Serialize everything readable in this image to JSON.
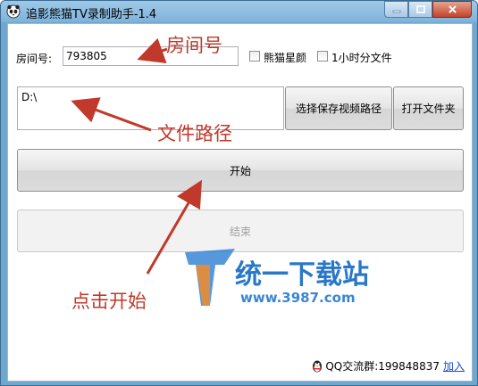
{
  "window": {
    "title": "追影熊猫TV录制助手-1.4"
  },
  "form": {
    "room_label": "房间号:",
    "room_value": "793805",
    "checkbox_panda_star": "熊猫星颜",
    "checkbox_hour_split": "1小时分文件",
    "path_value": "D:\\",
    "choose_path_button": "选择保存视频路径",
    "open_folder_button": "打开文件夹",
    "start_button": "开始",
    "stop_button": "结束"
  },
  "annotations": {
    "room": "房间号",
    "path": "文件路径",
    "click_start": "点击开始"
  },
  "watermark": {
    "name": "统一下载站",
    "url": "www.3987.com"
  },
  "footer": {
    "qq_group": "QQ交流群:199848837",
    "join_link": "加入"
  },
  "colors": {
    "annotation_red": "#c0392b",
    "link_blue": "#1a4fd0"
  }
}
